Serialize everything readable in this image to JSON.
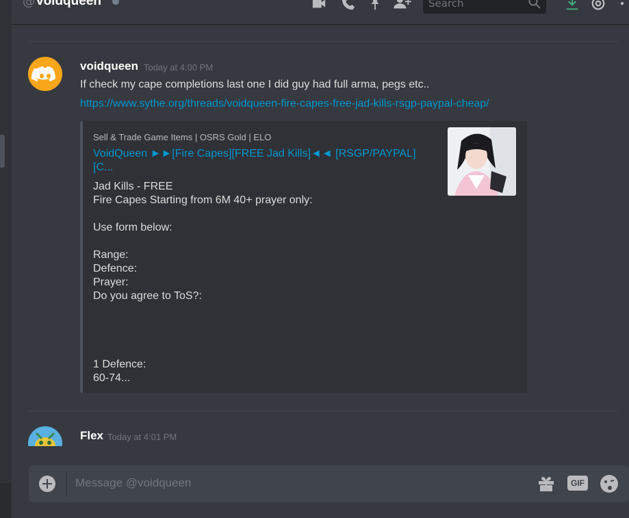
{
  "header": {
    "at_symbol": "@",
    "channel_name": "voidqueen",
    "search_placeholder": "Search"
  },
  "messages": [
    {
      "author": "voidqueen",
      "timestamp": "Today at 4:00 PM",
      "text": "If check my cape completions last one I did guy had full arma, pegs etc..",
      "link": "https://www.sythe.org/threads/voidqueen-fire-capes-free-jad-kills-rsgp-paypal-cheap/",
      "embed": {
        "provider": "Sell & Trade Game Items | OSRS Gold | ELO",
        "title": "VoidQueen ►►[Fire Capes][FREE Jad Kills]◄◄ [RSGP/PAYPAL] [C...",
        "description": "Jad Kills - FREE\nFire Capes Starting from 6M 40+ prayer only:\n\nUse form below:\n\nRange:\nDefence:\nPrayer:\nDo you agree to ToS?:\n\n\n\n\n1 Defence:\n60-74..."
      }
    },
    {
      "author": "Flex",
      "timestamp": "Today at 4:01 PM"
    }
  ],
  "composer": {
    "placeholder": "Message @voidqueen",
    "gif_label": "GIF"
  },
  "colors": {
    "background": "#36393f",
    "link": "#0096cf",
    "discord_avatar_orange": "#faa61a"
  },
  "icons": [
    "video-call-icon",
    "phone-call-icon",
    "pin-icon",
    "add-friend-icon",
    "search-icon",
    "download-icon",
    "mention-icon",
    "more-icon",
    "attach-plus-icon",
    "gift-icon",
    "emoji-icon"
  ]
}
